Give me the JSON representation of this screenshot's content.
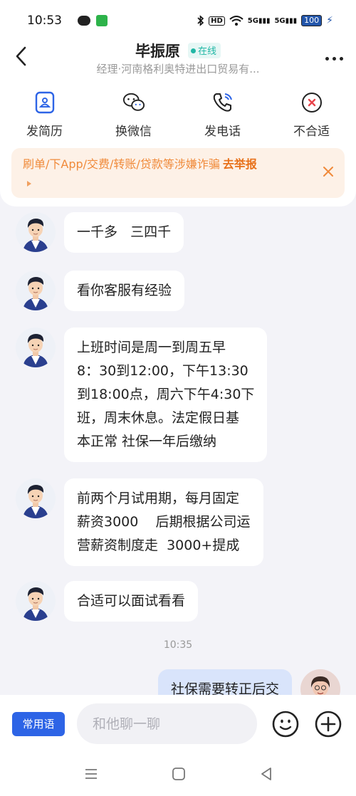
{
  "status_bar": {
    "time": "10:53",
    "signal_1": "5G",
    "signal_2": "5G",
    "battery": "100"
  },
  "header": {
    "name": "毕振原",
    "online": "在线",
    "subtitle": "经理·河南格利奥特进出口贸易有..."
  },
  "actions": [
    {
      "label": "发简历",
      "icon": "resume-icon"
    },
    {
      "label": "换微信",
      "icon": "wechat-icon"
    },
    {
      "label": "发电话",
      "icon": "phone-icon"
    },
    {
      "label": "不合适",
      "icon": "reject-icon"
    }
  ],
  "warning": {
    "text": "刷单/下App/交费/转账/贷款等涉嫌诈骗",
    "action": "去举报"
  },
  "messages": [
    {
      "from": "other",
      "lines": [
        "一千多   三四千"
      ]
    },
    {
      "from": "other",
      "lines": [
        "看你客服有经验"
      ]
    },
    {
      "from": "other",
      "lines": [
        "上班时间是周一到周五早",
        "8：30到12:00，下午13:30",
        "到18:00点，周六下午4:30下",
        "班，周末休息。法定假日基",
        "本正常 社保一年后缴纳"
      ]
    },
    {
      "from": "other",
      "lines": [
        "前两个月试用期，每月固定",
        "薪资3000    后期根据公司运",
        "营薪资制度走  3000+提成"
      ]
    },
    {
      "from": "other",
      "lines": [
        "合适可以面试看看"
      ]
    },
    {
      "from": "time",
      "lines": [
        "10:35"
      ]
    },
    {
      "from": "me",
      "lines": [
        "社保需要转正后交"
      ]
    }
  ],
  "input_bar": {
    "common_phrases": "常用语",
    "placeholder": "和他聊一聊"
  },
  "colors": {
    "accent": "#2d64e6",
    "online": "#21b7a5",
    "warning_text": "#f08a3a",
    "warning_bg": "#fdf1e7",
    "reject": "#e8434a"
  }
}
